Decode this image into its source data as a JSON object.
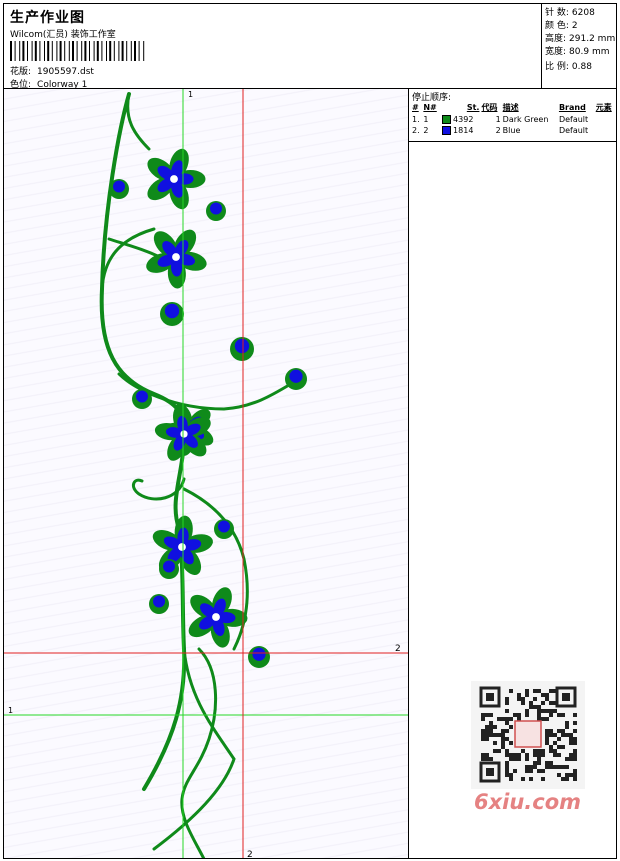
{
  "header": {
    "title": "生产作业图",
    "studio": "Wilcom(汇员) 装饰工作室",
    "design_label": "花版:",
    "design_value": "1905597.dst",
    "colorway_label": "色位:",
    "colorway_value": "Colorway 1"
  },
  "stats": [
    {
      "label": "针 数:",
      "value": "6208"
    },
    {
      "label": "颜 色:",
      "value": "2"
    },
    {
      "label": "高度:",
      "value": "291.2 mm"
    },
    {
      "label": "宽度:",
      "value": "80.9 mm"
    },
    {
      "label": "比 例:",
      "value": "0.88"
    }
  ],
  "stop_sequence": {
    "title": "停止顺序:",
    "columns": [
      "#",
      "N#",
      "St.",
      "代码",
      "描述",
      "Brand",
      "元素"
    ],
    "rows": [
      {
        "num": "1.",
        "n": "1",
        "color": "#0f8a1a",
        "stitches": "4392",
        "code": "1",
        "description": "Dark Green",
        "brand": "Default"
      },
      {
        "num": "2.",
        "n": "2",
        "color": "#1010e0",
        "stitches": "1814",
        "code": "2",
        "description": "Blue",
        "brand": "Default"
      }
    ]
  },
  "guides": {
    "green_vertical_label": "1",
    "green_horizontal_label": "1",
    "red_vertical_label": "2",
    "red_horizontal_label": "2"
  },
  "colors": {
    "thread_green": "#0f8a1a",
    "thread_blue": "#1010e0",
    "guide_green": "#27d827",
    "guide_red": "#e02020",
    "watermark": "#e58282"
  },
  "watermark": {
    "text": "6xiu.com"
  }
}
